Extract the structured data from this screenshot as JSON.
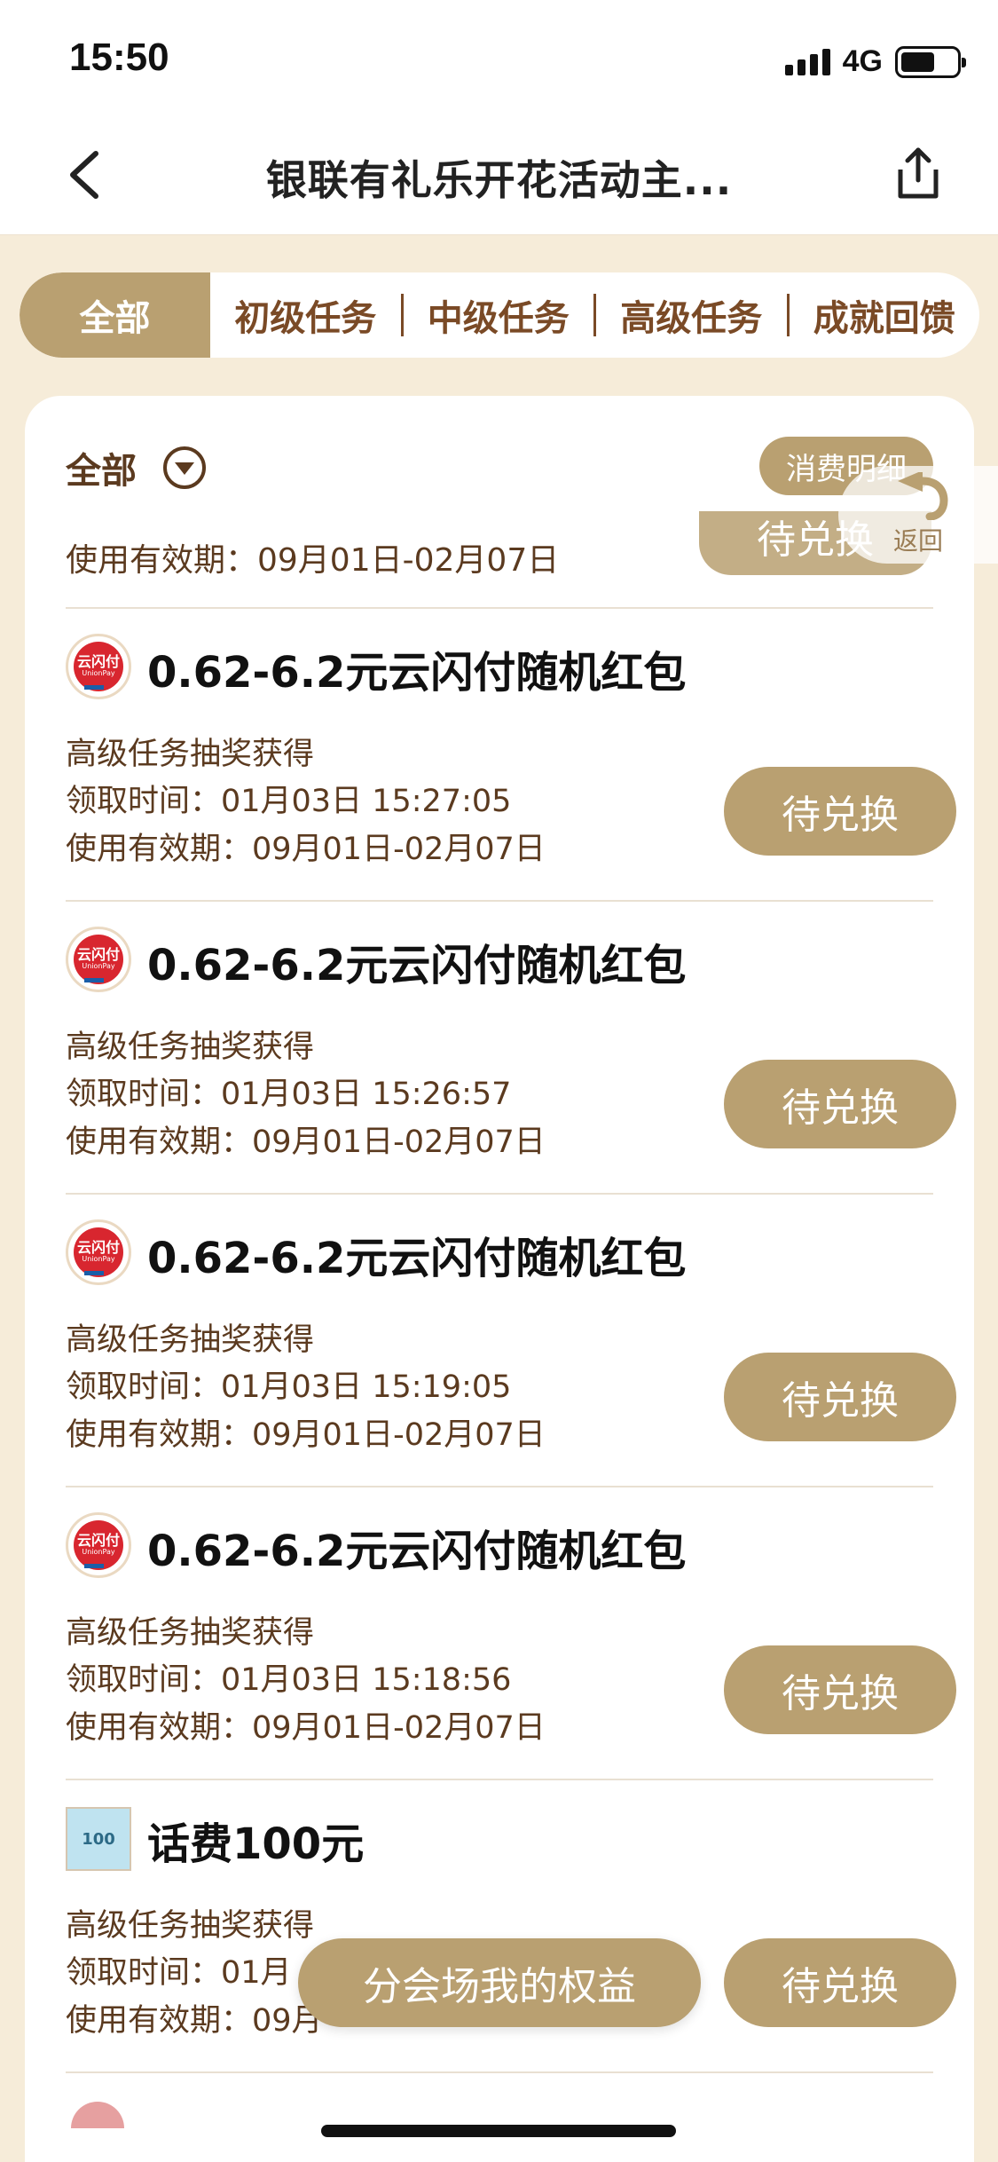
{
  "status": {
    "time": "15:50",
    "network": "4G"
  },
  "nav": {
    "title": "银联有礼乐开花活动主..."
  },
  "tabs": {
    "active": "全部",
    "items": [
      "初级任务",
      "中级任务",
      "高级任务",
      "成就回馈"
    ]
  },
  "filter": {
    "label": "全部",
    "detail_button": "消费明细",
    "back_label": "返回"
  },
  "partial_item": {
    "validity": "使用有效期：09月01日-02月07日",
    "button": "待兑换"
  },
  "items": [
    {
      "icon": "unionpay-icon",
      "title": "0.62-6.2元云闪付随机红包",
      "source": "高级任务抽奖获得",
      "received": "领取时间：01月03日 15:27:05",
      "validity": "使用有效期：09月01日-02月07日",
      "button": "待兑换"
    },
    {
      "icon": "unionpay-icon",
      "title": "0.62-6.2元云闪付随机红包",
      "source": "高级任务抽奖获得",
      "received": "领取时间：01月03日 15:26:57",
      "validity": "使用有效期：09月01日-02月07日",
      "button": "待兑换"
    },
    {
      "icon": "unionpay-icon",
      "title": "0.62-6.2元云闪付随机红包",
      "source": "高级任务抽奖获得",
      "received": "领取时间：01月03日 15:19:05",
      "validity": "使用有效期：09月01日-02月07日",
      "button": "待兑换"
    },
    {
      "icon": "unionpay-icon",
      "title": "0.62-6.2元云闪付随机红包",
      "source": "高级任务抽奖获得",
      "received": "领取时间：01月03日 15:18:56",
      "validity": "使用有效期：09月01日-02月07日",
      "button": "待兑换"
    },
    {
      "icon": "phone-credit-icon",
      "title": "话费100元",
      "source": "高级任务抽奖获得",
      "received": "领取时间：01月",
      "validity": "使用有效期：09月",
      "button": "待兑换"
    }
  ],
  "icon_text": {
    "unionpay": "云闪付",
    "unionpay_sub": "UnionPay",
    "phone": "100"
  },
  "floating_button": "分会场我的权益",
  "colors": {
    "accent": "#b9a071",
    "text_brown": "#5b3a1f",
    "background": "#f6ecd9"
  }
}
